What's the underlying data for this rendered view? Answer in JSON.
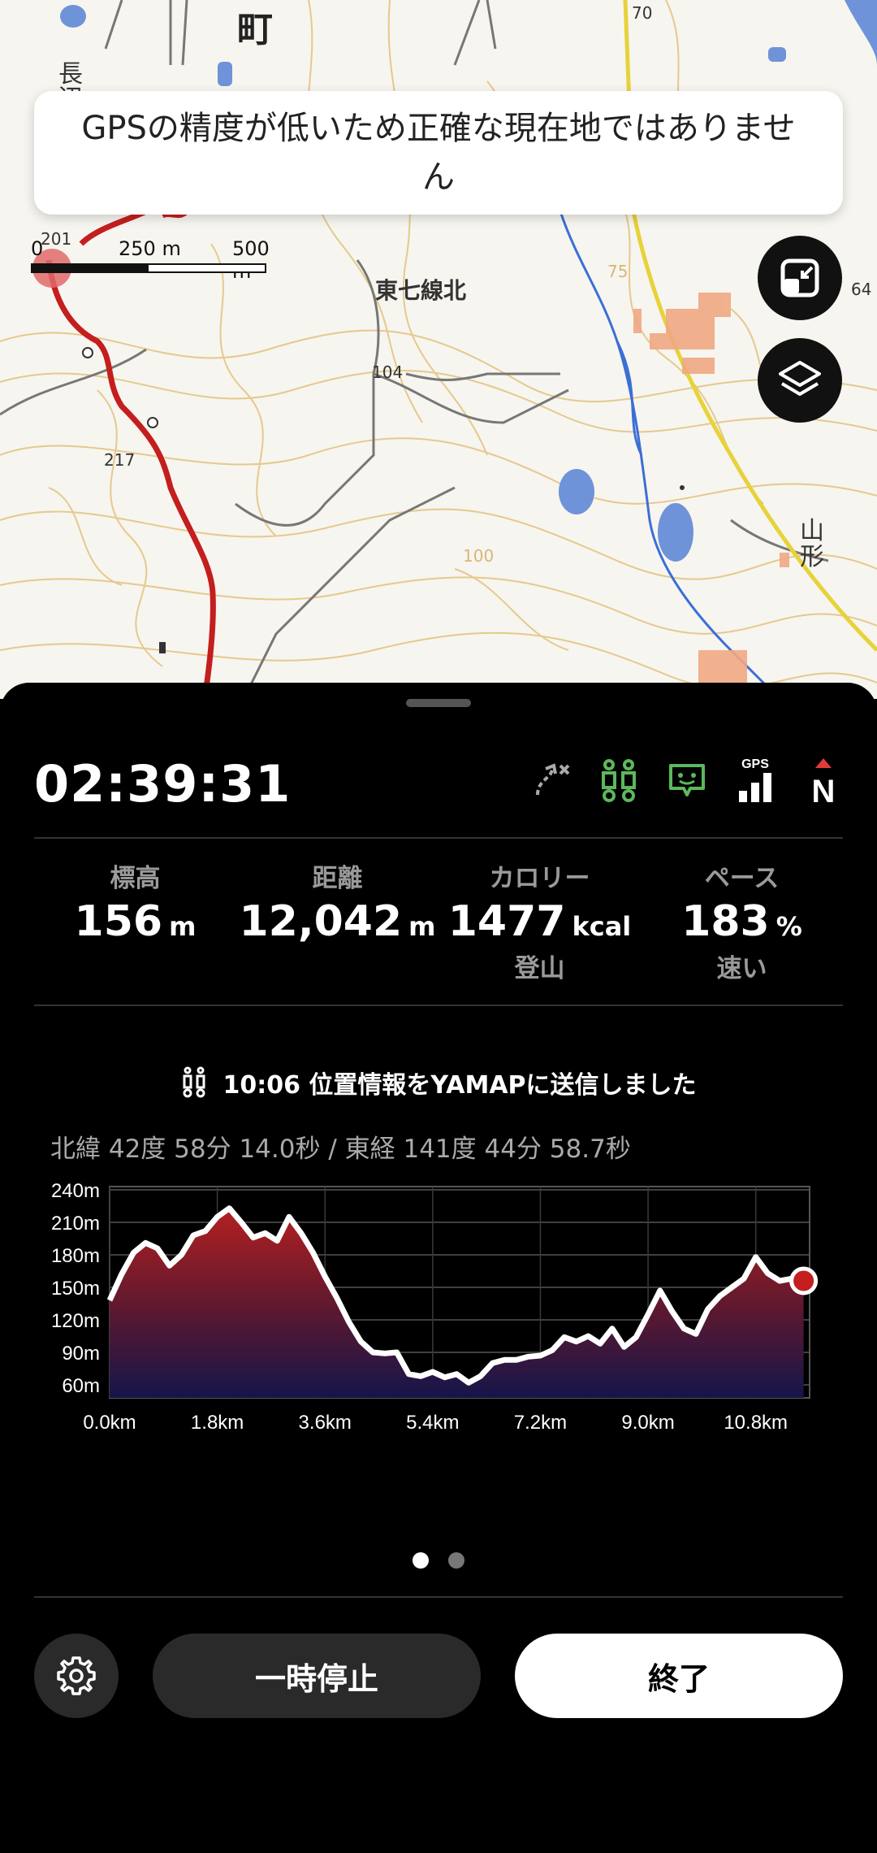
{
  "map": {
    "gps_warning": "GPSの精度が低いため正確な現在地ではありません",
    "scale": {
      "zero": "0",
      "mid": "250 m",
      "max": "500 m"
    },
    "labels": {
      "town_char": "町",
      "place_vertical_1": "長",
      "place_vertical_2": "辺",
      "higashi": "東七線北",
      "yamagata_1": "山",
      "yamagata_2": "形",
      "elev_217": "217",
      "elev_104": "104",
      "elev_201": "201",
      "elev_70": "70",
      "elev_100": "100",
      "elev_75": "75",
      "elev_64": "64"
    },
    "buttons": {
      "fit_icon": "fit-to-screen-icon",
      "layers_icon": "layers-icon"
    }
  },
  "tracker": {
    "elapsed_time": "02:39:31",
    "status_icons": [
      "route-deviation-icon",
      "people-share-icon",
      "message-icon",
      "gps-signal-icon",
      "north-compass-icon"
    ],
    "gps_label": "GPS",
    "compass_label": "N",
    "stats": [
      {
        "label": "標高",
        "value": "156",
        "unit": "m",
        "sub": ""
      },
      {
        "label": "距離",
        "value": "12,042",
        "unit": "m",
        "sub": ""
      },
      {
        "label": "カロリー",
        "value": "1477",
        "unit": "kcal",
        "sub": "登山"
      },
      {
        "label": "ペース",
        "value": "183",
        "unit": "%",
        "sub": "速い"
      }
    ],
    "sent_message": "10:06 位置情報をYAMAPに送信しました",
    "coordinates": "北緯 42度 58分 14.0秒 / 東経 141度 44分 58.7秒"
  },
  "chart_data": {
    "type": "area",
    "title": "",
    "xlabel": "",
    "ylabel": "",
    "x_unit": "km",
    "y_unit": "m",
    "xlim": [
      0,
      11.7
    ],
    "ylim": [
      48,
      243
    ],
    "x_ticks": [
      "0.0km",
      "1.8km",
      "3.6km",
      "5.4km",
      "7.2km",
      "9.0km",
      "10.8km"
    ],
    "y_ticks": [
      "240m",
      "210m",
      "180m",
      "150m",
      "120m",
      "90m",
      "60m"
    ],
    "grid": true,
    "x": [
      0.0,
      0.2,
      0.4,
      0.6,
      0.8,
      1.0,
      1.2,
      1.4,
      1.6,
      1.8,
      2.0,
      2.2,
      2.4,
      2.6,
      2.8,
      3.0,
      3.2,
      3.4,
      3.6,
      3.8,
      4.0,
      4.2,
      4.4,
      4.6,
      4.8,
      5.0,
      5.2,
      5.4,
      5.6,
      5.8,
      6.0,
      6.2,
      6.4,
      6.6,
      6.8,
      7.0,
      7.2,
      7.4,
      7.6,
      7.8,
      8.0,
      8.2,
      8.4,
      8.6,
      8.8,
      9.0,
      9.2,
      9.4,
      9.6,
      9.8,
      10.0,
      10.2,
      10.4,
      10.6,
      10.8,
      11.0,
      11.2,
      11.4,
      11.6
    ],
    "y": [
      138,
      162,
      182,
      191,
      186,
      170,
      180,
      198,
      202,
      215,
      223,
      210,
      196,
      200,
      193,
      215,
      200,
      182,
      160,
      140,
      118,
      100,
      90,
      89,
      90,
      70,
      68,
      72,
      67,
      70,
      62,
      68,
      80,
      83,
      83,
      86,
      87,
      92,
      104,
      100,
      105,
      98,
      112,
      95,
      104,
      125,
      147,
      128,
      112,
      107,
      130,
      142,
      150,
      158,
      178,
      163,
      156,
      158,
      156
    ],
    "current_point": {
      "x": 11.6,
      "y": 156
    },
    "series": [
      {
        "values_ref": "y"
      }
    ]
  },
  "pager": {
    "pages": 2,
    "active": 0
  },
  "actions": {
    "settings_icon": "gear-icon",
    "pause_label": "一時停止",
    "finish_label": "終了"
  }
}
